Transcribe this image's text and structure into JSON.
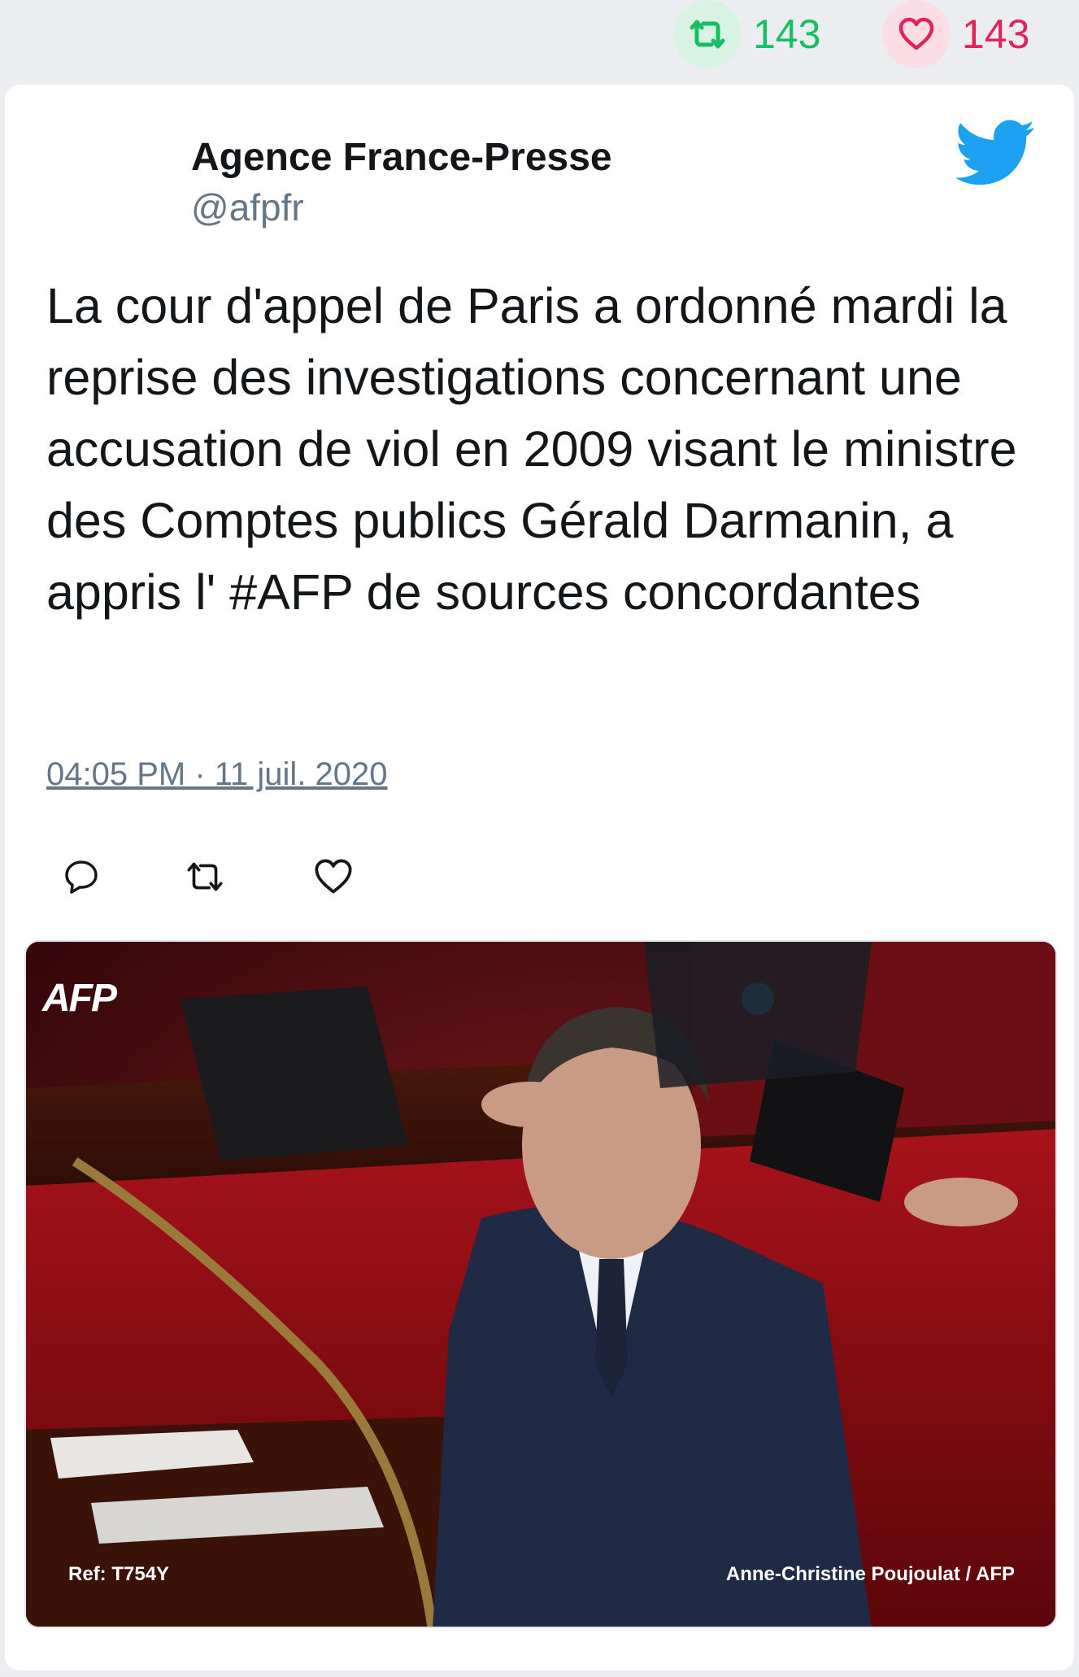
{
  "stats": {
    "retweets": "143",
    "likes": "143"
  },
  "author": {
    "name": "Agence France-Presse",
    "handle": "@afpfr"
  },
  "tweet": {
    "text": "La cour d'appel de Paris a ordonné mardi la reprise des investigations concernant une accusation de viol en 2009 visant le ministre des Comptes publics Gérald Darmanin, a appris l' #AFP de sources concordantes",
    "timestamp": "04:05 PM · 11 juil. 2020"
  },
  "media": {
    "logo_text": "AFP",
    "ref_caption": "Ref: T754Y",
    "credit_caption": "Anne-Christine Poujoulat / AFP"
  },
  "icons": {
    "retweet": "retweet-icon",
    "like": "heart-icon",
    "reply": "reply-icon",
    "brand": "twitter-bird-icon"
  },
  "colors": {
    "retweet_green": "#17bf63",
    "like_red": "#e0245e",
    "twitter_blue": "#1da1f2",
    "text_dark": "#14171a",
    "text_muted": "#657786"
  }
}
